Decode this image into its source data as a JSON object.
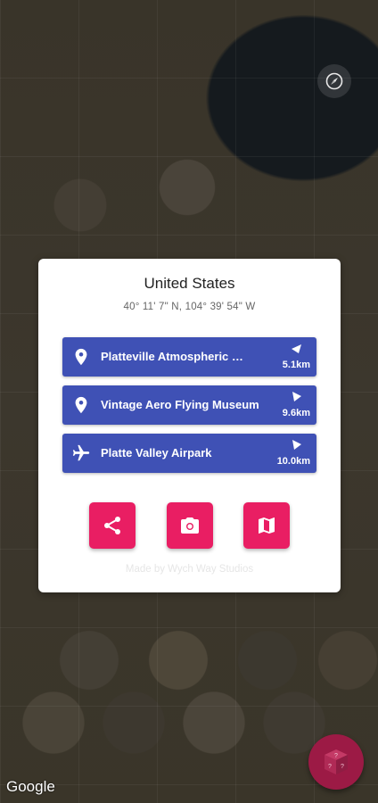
{
  "map": {
    "attribution": "Google"
  },
  "info_card": {
    "country": "United States",
    "coordinates": "40° 11' 7\" N, 104° 39' 54\" W",
    "places": [
      {
        "name": "Platteville Atmospheric …",
        "distance": "5.1km",
        "icon": "location-pin-icon",
        "direction": "west"
      },
      {
        "name": "Vintage Aero Flying Museum",
        "distance": "9.6km",
        "icon": "location-pin-icon",
        "direction": "northeast"
      },
      {
        "name": "Platte Valley Airpark",
        "distance": "10.0km",
        "icon": "airplane-icon",
        "direction": "northeast"
      }
    ],
    "actions": [
      {
        "label": "share",
        "icon": "share-icon"
      },
      {
        "label": "camera",
        "icon": "camera-icon"
      },
      {
        "label": "map",
        "icon": "map-icon"
      }
    ],
    "credit": "Made by Wych Way Studios"
  },
  "colors": {
    "place_bg": "#3f51b5",
    "action_bg": "#e91e63",
    "fab_bg": "#9c1a45"
  }
}
